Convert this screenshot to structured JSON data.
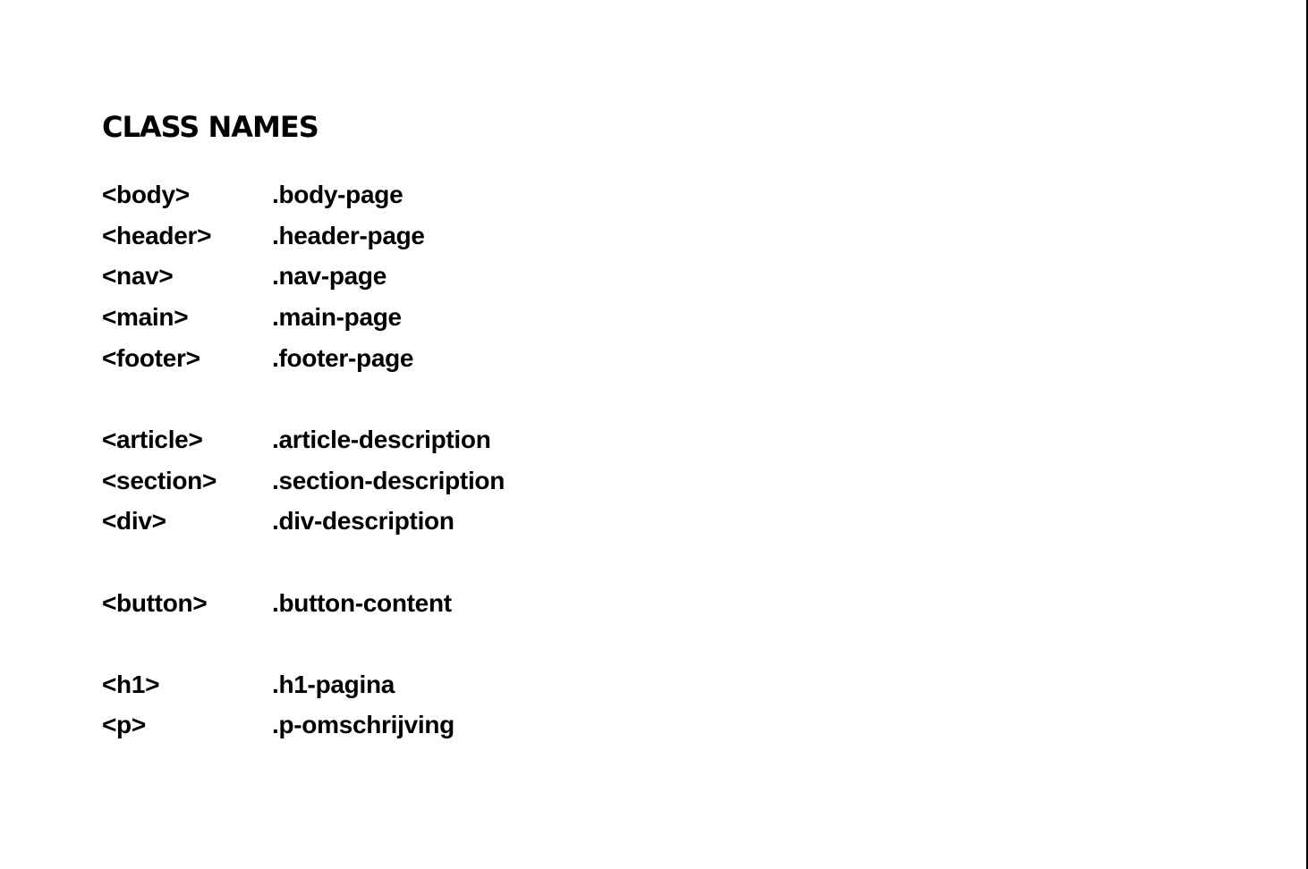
{
  "document": {
    "title": "CLASS NAMES",
    "groups": [
      {
        "rows": [
          {
            "tag": "<body>",
            "class_name": ".body-page"
          },
          {
            "tag": "<header>",
            "class_name": ".header-page"
          },
          {
            "tag": "<nav>",
            "class_name": ".nav-page"
          },
          {
            "tag": "<main>",
            "class_name": ".main-page"
          },
          {
            "tag": "<footer>",
            "class_name": ".footer-page"
          }
        ]
      },
      {
        "rows": [
          {
            "tag": "<article>",
            "class_name": ".article-description"
          },
          {
            "tag": "<section>",
            "class_name": ".section-description"
          },
          {
            "tag": "<div>",
            "class_name": ".div-description"
          }
        ]
      },
      {
        "rows": [
          {
            "tag": "<button>",
            "class_name": ".button-content"
          }
        ]
      },
      {
        "rows": [
          {
            "tag": "<h1>",
            "class_name": ".h1-pagina"
          },
          {
            "tag": "<p>",
            "class_name": ".p-omschrijving"
          }
        ]
      }
    ]
  }
}
